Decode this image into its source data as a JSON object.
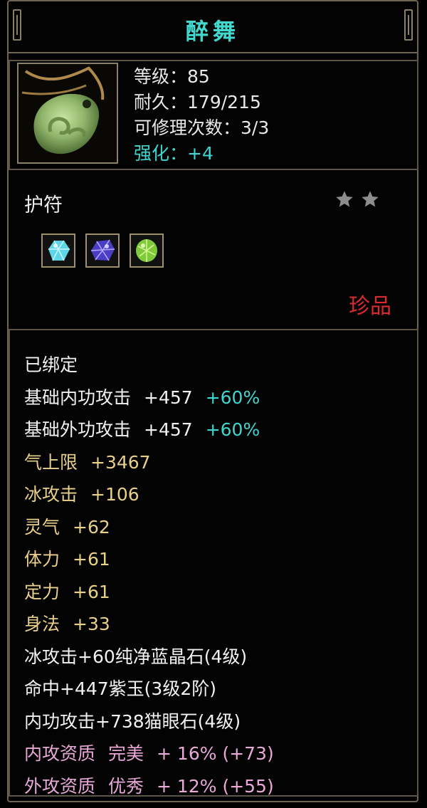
{
  "title": "醉舞",
  "header": {
    "level_label": "等级：",
    "level_value": "85",
    "durability_label": "耐久：",
    "durability_value": "179/215",
    "repair_label": "可修理次数：",
    "repair_value": "3/3",
    "enhance_label": "强化：",
    "enhance_value": "+4"
  },
  "item_type": "护符",
  "stars": 2,
  "gems": [
    "cyan-gem-icon",
    "purple-gem-icon",
    "green-gem-icon"
  ],
  "rarity": "珍品",
  "attributes": {
    "bound": "已绑定",
    "inner_attack": {
      "label": "基础内功攻击",
      "value": "+457",
      "bonus": "+60%"
    },
    "outer_attack": {
      "label": "基础外功攻击",
      "value": "+457",
      "bonus": "+60%"
    },
    "qi_cap": {
      "label": "气上限",
      "value": "+3467"
    },
    "ice_attack": {
      "label": "冰攻击",
      "value": "+106"
    },
    "spirit": {
      "label": "灵气",
      "value": "+62"
    },
    "stamina": {
      "label": "体力",
      "value": "+61"
    },
    "focus": {
      "label": "定力",
      "value": "+61"
    },
    "agility": {
      "label": "身法",
      "value": "+33"
    },
    "gem_line_1": "冰攻击+60纯净蓝晶石(4级)",
    "gem_line_2": "命中+447紫玉(3级2阶)",
    "gem_line_3": "内功攻击+738猫眼石(4级)",
    "inner_quality": {
      "label": "内攻资质",
      "grade": "完美",
      "value": "+ 16% (+73)"
    },
    "outer_quality": {
      "label": "外攻资质",
      "grade": "优秀",
      "value": "+ 12% (+55)"
    }
  },
  "colors": {
    "title": "#41d9cd",
    "enhance": "#3fd6d0",
    "rarity": "#d82b2b",
    "base_attr": "#e8cf8a",
    "quality": "#e8a9d7",
    "border": "#6e6550"
  }
}
